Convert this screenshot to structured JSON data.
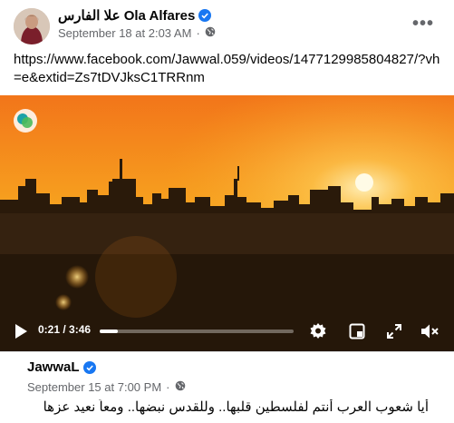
{
  "post": {
    "author_name": "علا الفارس Ola Alfares",
    "timestamp": "September 18 at 2:03 AM",
    "separator": "·",
    "audience_icon": "globe-icon",
    "more_icon": "more-options-icon",
    "more_label": "•••",
    "text": "https://www.facebook.com/Jawwal.059/videos/1477129985804827/?vh=e&extid=Zs7tDVJksC1TRRnm"
  },
  "video": {
    "current_time": "0:21",
    "duration": "3:46",
    "time_display": "0:21 / 3:46",
    "progress_fraction": 0.093,
    "controls": [
      "play-icon",
      "settings-icon",
      "picture-in-picture-icon",
      "fullscreen-icon",
      "volume-muted-icon"
    ],
    "brand_logo": "jawwal-logo-icon"
  },
  "shared": {
    "author_name": "JawwaL",
    "timestamp": "September 15 at 7:00 PM",
    "separator": "·",
    "audience_icon": "globe-icon",
    "text": "أيا شعوب العرب أنتم لفلسطين قلبها.. وللقدس نبضها.. ومعاً نعيد عزها"
  },
  "colors": {
    "verified": "#1877f2",
    "meta_text": "#65676b",
    "sky_top": "#f07a1a",
    "sky_glow": "#ffc84a"
  }
}
